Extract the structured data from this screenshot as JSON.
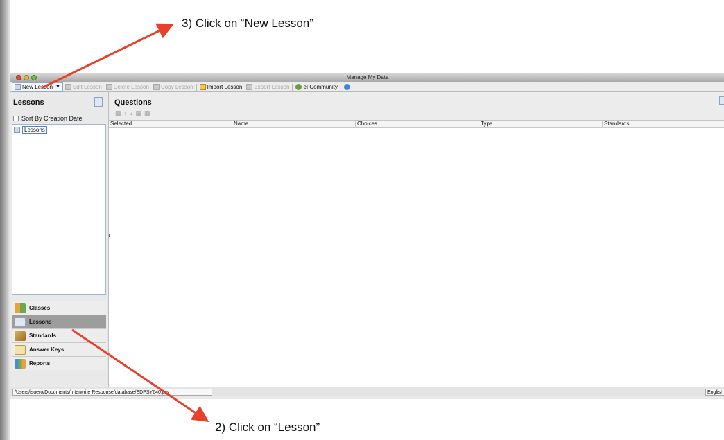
{
  "annotations": {
    "step3": "3) Click on “New Lesson”",
    "step2": "2) Click on “Lesson”",
    "arrow_color": "#e8402b"
  },
  "window": {
    "title": "Manage My Data"
  },
  "toolbar": {
    "new_lesson": "New Lesson",
    "edit_lesson": "Edit Lesson",
    "delete_lesson": "Delete Lesson",
    "copy_lesson": "Copy Lesson",
    "import_lesson": "Import Lesson",
    "export_lesson": "Export Lesson",
    "community": "eI Community"
  },
  "left_panel": {
    "title": "Lessons",
    "sort_label": "Sort By Creation Date",
    "tree_root": "Lessons",
    "nav": [
      {
        "label": "Classes",
        "icon": "classes-icon"
      },
      {
        "label": "Lessons",
        "icon": "lessons-icon",
        "selected": true
      },
      {
        "label": "Standards",
        "icon": "standards-icon"
      },
      {
        "label": "Answer Keys",
        "icon": "answer-keys-icon"
      },
      {
        "label": "Reports",
        "icon": "reports-icon"
      }
    ]
  },
  "questions_panel": {
    "title": "Questions",
    "columns": [
      "Selected",
      "Name",
      "Choices",
      "Type",
      "Standards"
    ]
  },
  "status_bar": {
    "path": "/Users/isuero/Documents/Interwrite Response/database/EDPSY640.prs",
    "language": "English"
  }
}
